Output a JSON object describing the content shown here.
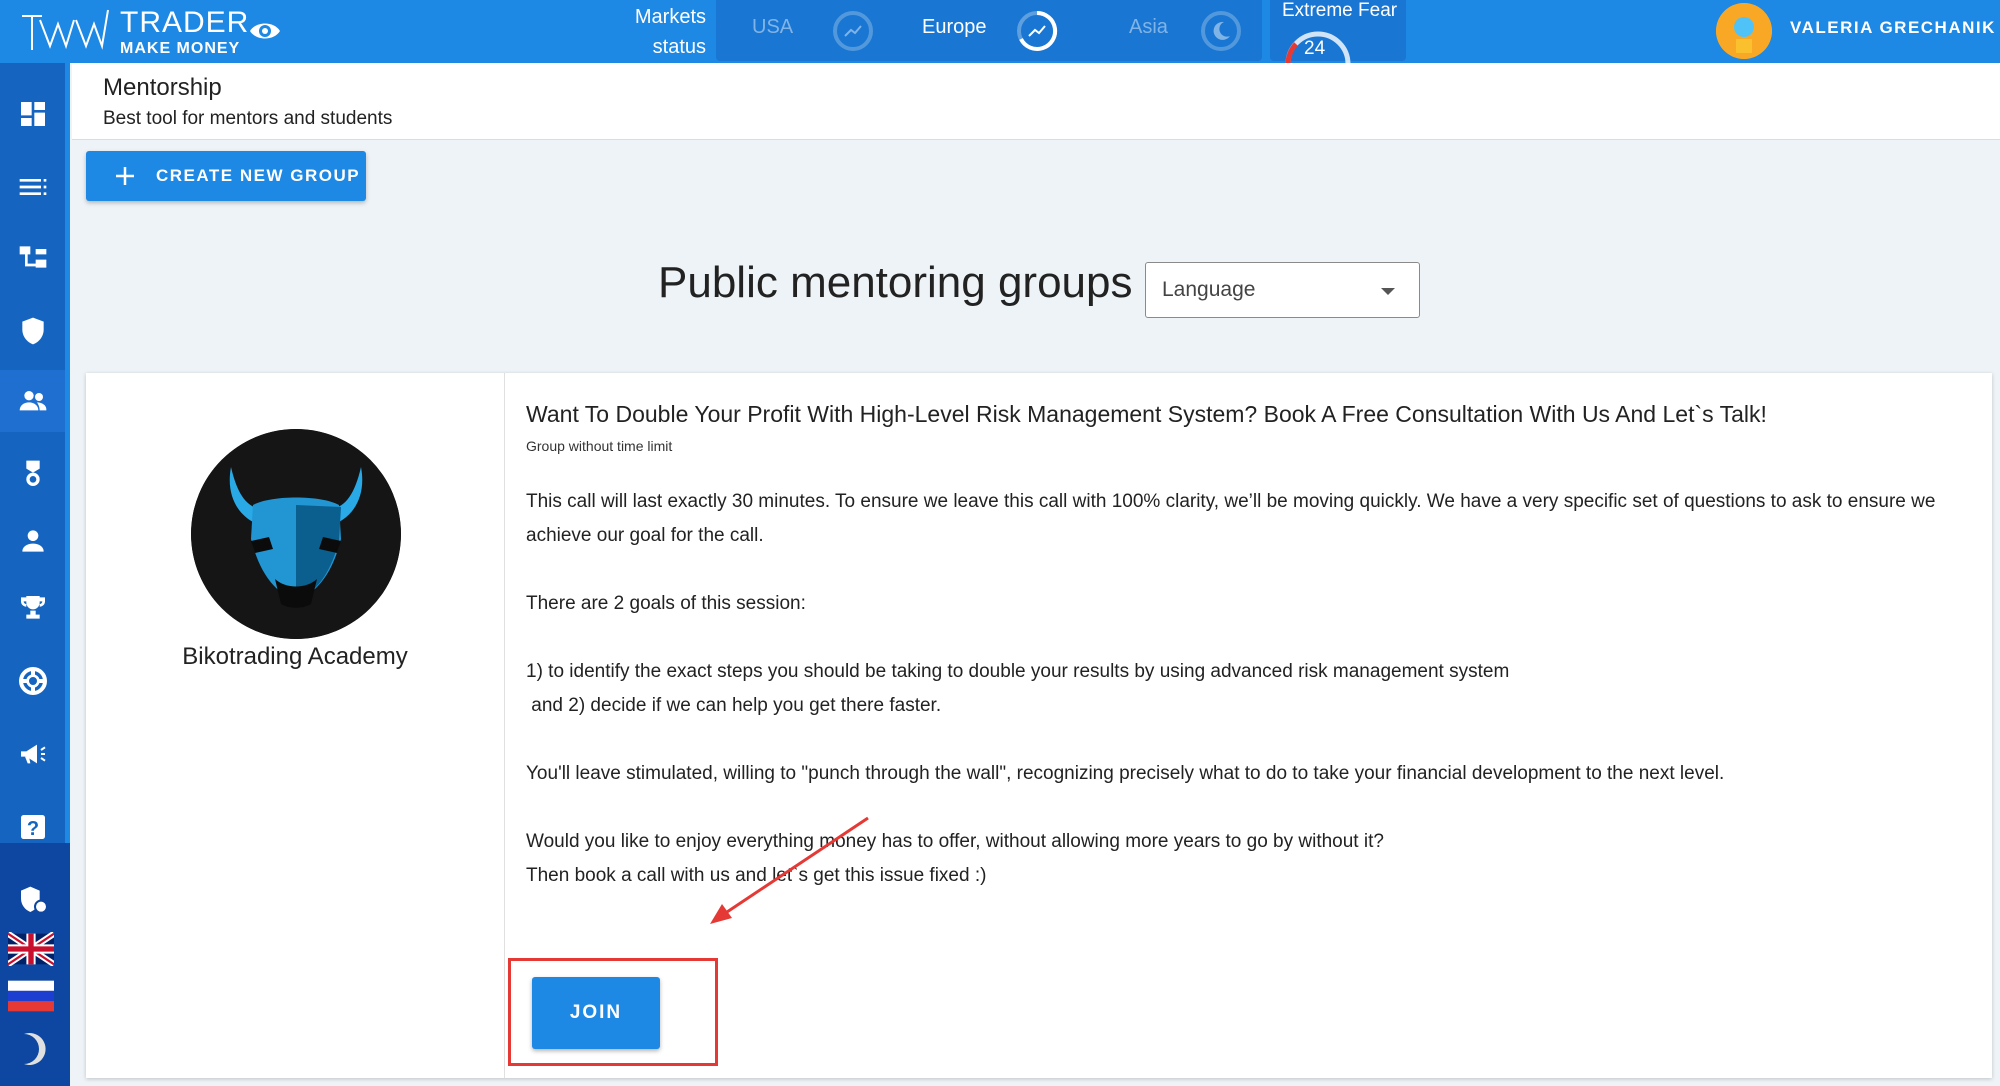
{
  "brand": {
    "line1": "TRADER",
    "line2": "MAKE MONEY"
  },
  "markets": {
    "status_label_1": "Markets",
    "status_label_2": "status",
    "items": [
      {
        "label": "USA",
        "state": "closed"
      },
      {
        "label": "Europe",
        "state": "open"
      },
      {
        "label": "Asia",
        "state": "closed"
      }
    ]
  },
  "sentiment": {
    "label": "Extreme Fear",
    "value": "24"
  },
  "user": {
    "name": "VALERIA GRECHANIK"
  },
  "sidebar": {
    "items": [
      {
        "icon": "dashboard-icon"
      },
      {
        "icon": "list-icon"
      },
      {
        "icon": "hierarchy-icon"
      },
      {
        "icon": "shield-icon"
      },
      {
        "icon": "group-icon",
        "active": true
      },
      {
        "icon": "medal-icon"
      },
      {
        "icon": "person-icon"
      },
      {
        "icon": "trophy-icon"
      },
      {
        "icon": "lifebuoy-icon"
      },
      {
        "icon": "megaphone-icon"
      },
      {
        "icon": "help-icon"
      },
      {
        "icon": "security-settings-icon"
      }
    ],
    "languages": [
      "English",
      "Russian"
    ]
  },
  "page": {
    "title": "Mentorship",
    "subtitle": "Best tool for mentors and students"
  },
  "actions": {
    "create_group": "CREATE NEW GROUP"
  },
  "groups_section": {
    "title": "Public mentoring groups",
    "language_placeholder": "Language"
  },
  "group": {
    "name": "Bikotrading Academy",
    "title": "Want To Double Your Profit With High-Level Risk Management System? Book A Free Consultation With Us And Let`s Talk!",
    "limit": "Group without time limit",
    "description": {
      "p1": "This call will last exactly 30 minutes. To ensure we leave this call with 100% clarity, we’ll be moving quickly. We have a very specific set of questions to ask to ensure we achieve our goal for the call.",
      "p2": "There are 2 goals of this session:",
      "p3a": "1) to identify the exact steps you should be taking to double your results by using advanced risk management system",
      "p3b": " and 2) decide if we can help you get there faster.",
      "p4": "You'll leave stimulated, willing to \"punch through the wall\", recognizing precisely what to do to take your financial development to the next level.",
      "p5a": "Would you like to enjoy everything money has to offer, without allowing more years to go by without it?",
      "p5b": "Then book a call with us and let`s get this issue fixed :)"
    },
    "join_label": "JOIN"
  },
  "colors": {
    "primary": "#1e88e5",
    "sidebar": "#1565c0",
    "annotation": "#e53935"
  }
}
